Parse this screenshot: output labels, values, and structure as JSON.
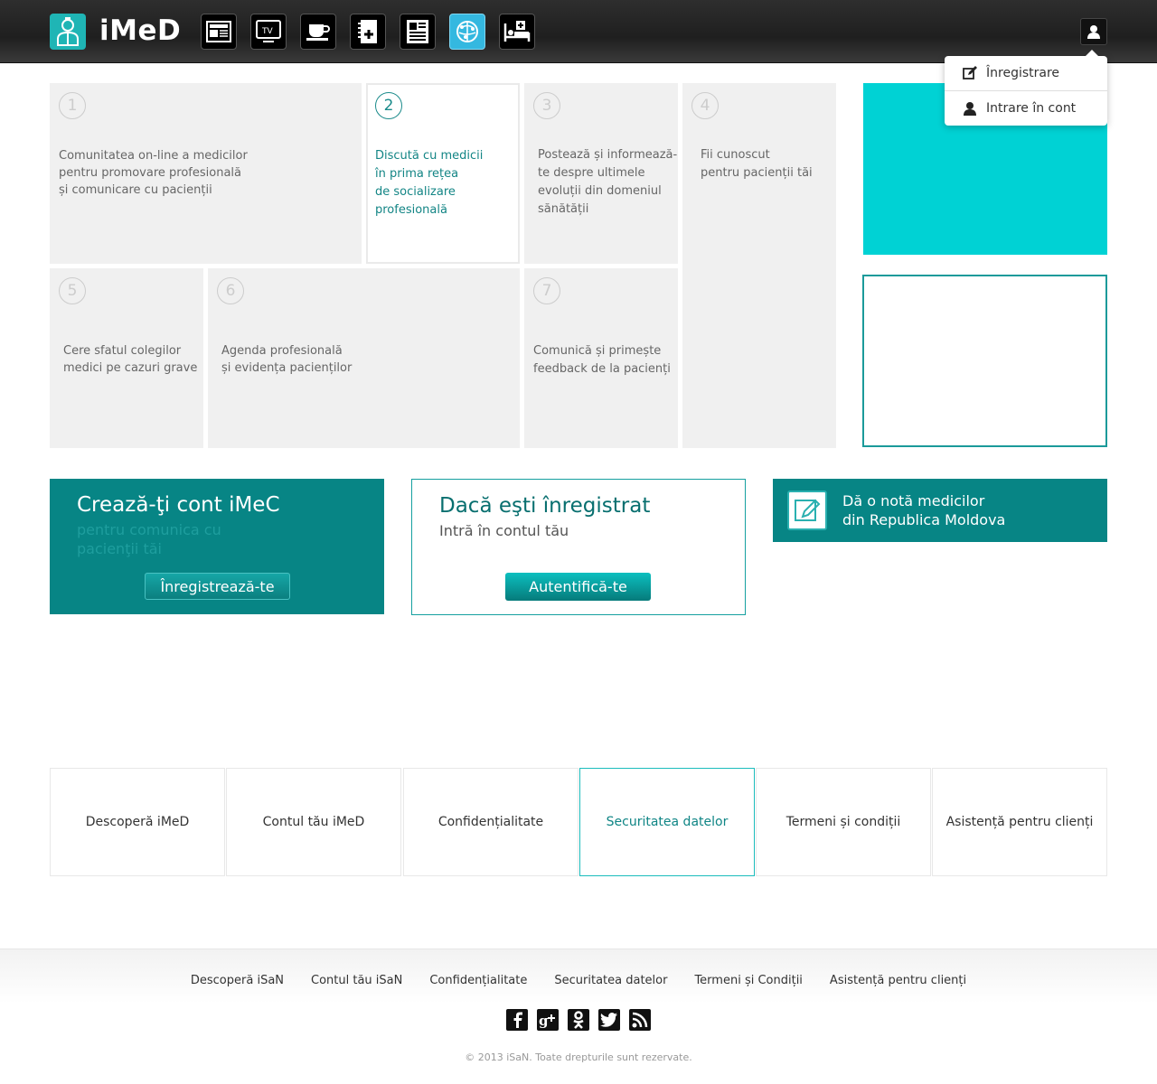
{
  "header": {
    "app_name": "iMeD",
    "nav_icons": [
      {
        "icon": "newspaper-icon",
        "active": false
      },
      {
        "icon": "tv-icon",
        "active": false
      },
      {
        "icon": "coffee-cup-icon",
        "active": false
      },
      {
        "icon": "medical-notebook-icon",
        "active": false
      },
      {
        "icon": "article-icon",
        "active": false
      },
      {
        "icon": "network-icon",
        "active": true
      },
      {
        "icon": "hospital-bed-icon",
        "active": false
      }
    ]
  },
  "dropdown": {
    "items": [
      {
        "icon": "edit-icon",
        "label": "Înregistrare"
      },
      {
        "icon": "user-icon",
        "label": "Intrare în cont"
      }
    ]
  },
  "tiles": [
    {
      "num": "1",
      "text": "Comunitatea on-line a medicilor\npentru promovare profesională\nși comunicare cu pacienții"
    },
    {
      "num": "2",
      "text": "Discută cu medicii\nîn prima rețea\nde socializare\nprofesională"
    },
    {
      "num": "3",
      "text": "Postează și informează-\nte despre ultimele\nevoluții din domeniul\nsănătății"
    },
    {
      "num": "4",
      "text": "Fii cunoscut\npentru pacienții tăi"
    },
    {
      "num": "5",
      "text": "Cere sfatul colegilor\nmedici pe cazuri grave"
    },
    {
      "num": "6",
      "text": "Agenda profesională\nși evidența pacienților"
    },
    {
      "num": "7",
      "text": "Comunică și primește\nfeedback de la pacienți"
    }
  ],
  "cta_register": {
    "title": "Crează-ţi cont iMeC",
    "subtitle": "pentru comunica cu pacienţii tăi",
    "button": "Înregistrează-te"
  },
  "cta_login": {
    "title": "Dacă eşti înregistrat",
    "subtitle": "Intră în contul tău",
    "button": "Autentifică-te"
  },
  "cta_rate": {
    "text": "Dă o notă medicilor\ndin Republica Moldova"
  },
  "info_links": [
    {
      "label": "Descoperă iMeD",
      "active": false
    },
    {
      "label": "Contul tău iMeD",
      "active": false
    },
    {
      "label": "Confidențialitate",
      "active": false
    },
    {
      "label": "Securitatea datelor",
      "active": true
    },
    {
      "label": "Termeni și condiții",
      "active": false
    },
    {
      "label": "Asistență pentru clienți",
      "active": false
    }
  ],
  "footer": {
    "links": [
      "Descoperă iSaN",
      "Contul tău iSaN",
      "Confidențialitate",
      "Securitatea datelor",
      "Termeni și Condiții",
      "Asistență pentru clienți"
    ],
    "social": [
      {
        "icon": "facebook-icon",
        "glyph": "f"
      },
      {
        "icon": "google-plus-icon",
        "glyph": "g+"
      },
      {
        "icon": "odnoklassniki-icon",
        "glyph": "ok"
      },
      {
        "icon": "twitter-icon",
        "glyph": "t"
      },
      {
        "icon": "rss-icon",
        "glyph": "rss"
      }
    ],
    "copyright": "© 2013 iSaN. Toate drepturile sunt rezervate."
  },
  "colors": {
    "teal": "#078585",
    "cyan": "#00d2d4",
    "active_nav": "#34b8e0"
  }
}
